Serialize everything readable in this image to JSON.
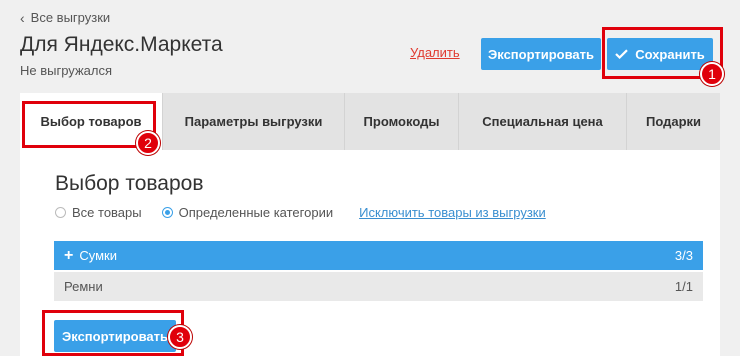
{
  "header": {
    "back_label": "Все выгрузки",
    "title": "Для Яндекс.Маркета",
    "status": "Не выгружался",
    "delete_label": "Удалить",
    "export_label": "Экспортировать",
    "save_label": "Сохранить"
  },
  "tabs": [
    {
      "label": "Выбор товаров",
      "active": true
    },
    {
      "label": "Параметры выгрузки",
      "active": false
    },
    {
      "label": "Промокоды",
      "active": false
    },
    {
      "label": "Специальная цена",
      "active": false
    },
    {
      "label": "Подарки",
      "active": false
    }
  ],
  "main": {
    "section_title": "Выбор товаров",
    "radio_all_label": "Все товары",
    "radio_categories_label": "Определенные категории",
    "selected_radio": "Определенные категории",
    "exclude_link_label": "Исключить товары из выгрузки",
    "categories": [
      {
        "name": "Сумки",
        "count": "3/3",
        "expanded": true
      },
      {
        "name": "Ремни",
        "count": "1/1",
        "expanded": false
      }
    ],
    "export_label": "Экспортировать"
  },
  "annotations": {
    "badge_1": "1",
    "badge_2": "2",
    "badge_3": "3",
    "highlight_color": "#e0000b"
  },
  "colors": {
    "accent": "#3aa0e8",
    "danger_link": "#e03a2f",
    "background": "#f0f0f0"
  }
}
